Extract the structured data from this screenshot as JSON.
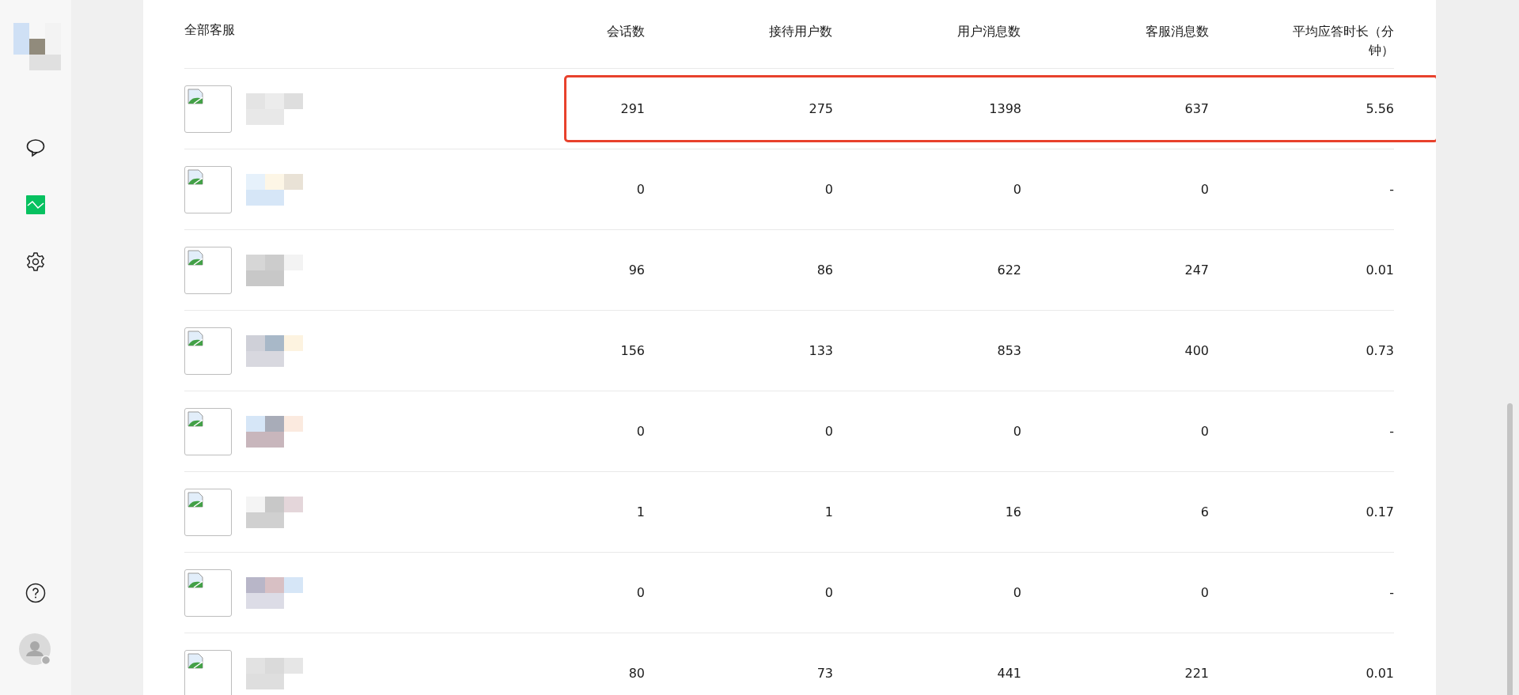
{
  "sidebar": {
    "items": [
      {
        "kind": "chat",
        "selected": false
      },
      {
        "kind": "stats",
        "selected": true
      },
      {
        "kind": "settings",
        "selected": false
      }
    ]
  },
  "table": {
    "name_column": "全部客服",
    "columns": [
      "会话数",
      "接待用户数",
      "用户消息数",
      "客服消息数",
      "平均应答时长（分钟）"
    ],
    "rows": [
      {
        "highlighted": true,
        "cells": [
          "291",
          "275",
          "1398",
          "637",
          "5.56"
        ]
      },
      {
        "highlighted": false,
        "cells": [
          "0",
          "0",
          "0",
          "0",
          "-"
        ]
      },
      {
        "highlighted": false,
        "cells": [
          "96",
          "86",
          "622",
          "247",
          "0.01"
        ]
      },
      {
        "highlighted": false,
        "cells": [
          "156",
          "133",
          "853",
          "400",
          "0.73"
        ]
      },
      {
        "highlighted": false,
        "cells": [
          "0",
          "0",
          "0",
          "0",
          "-"
        ]
      },
      {
        "highlighted": false,
        "cells": [
          "1",
          "1",
          "16",
          "6",
          "0.17"
        ]
      },
      {
        "highlighted": false,
        "cells": [
          "0",
          "0",
          "0",
          "0",
          "-"
        ]
      },
      {
        "highlighted": false,
        "cells": [
          "80",
          "73",
          "441",
          "221",
          "0.01"
        ]
      }
    ]
  }
}
